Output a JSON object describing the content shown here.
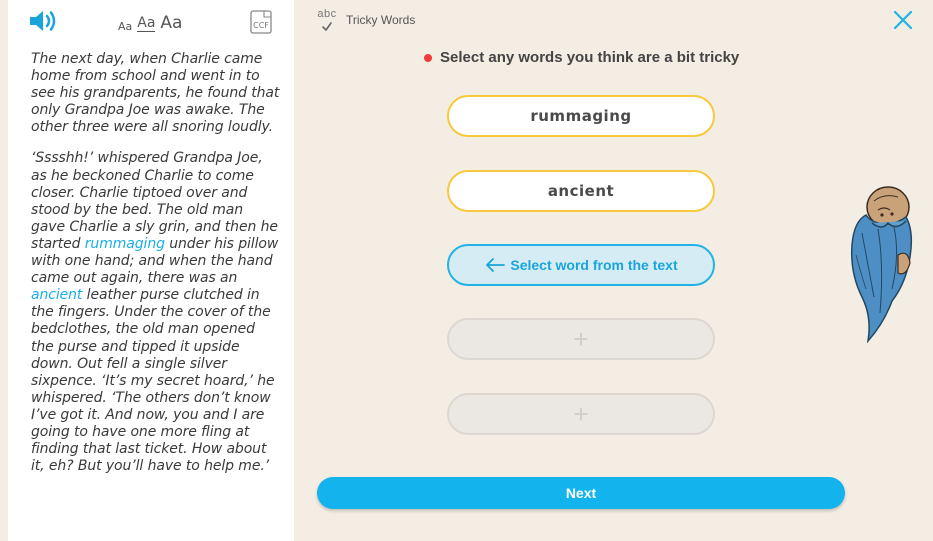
{
  "reader": {
    "font_size_small": "Aa",
    "font_size_medium": "Aa",
    "font_size_large": "Aa",
    "ccf_label": "CCF",
    "passage": [
      [
        {
          "t": "The next day, when Charlie came home from school and went in to see his grandparents, he found that only Grandpa Joe was awake. The other three were all snoring loudly."
        }
      ],
      [
        {
          "t": "‘Sssshh!’ whispered Grandpa Joe, as he beckoned Charlie to come closer. Charlie tiptoed over and stood by the bed. The old man gave Charlie a sly grin, and then he started "
        },
        {
          "t": "rummaging",
          "hl": true
        },
        {
          "t": " under his pillow with one hand; and when the hand came out again, there was an "
        },
        {
          "t": "ancient",
          "hl": true
        },
        {
          "t": " leather purse clutched in the fingers. Under the cover of the bedclothes, the old man opened the purse and tipped it upside down. Out fell a single silver sixpence. ‘It’s my secret hoard,’ he whispered. ‘The others don’t know I’ve got it. And now, you and I are going to have one more fling at finding that last ticket. How about it, eh? But you’ll have to help me.’"
        }
      ]
    ]
  },
  "header": {
    "icon_label": "abc",
    "title": "Tricky Words"
  },
  "prompt": "Select any words you think are a bit tricky",
  "words": [
    "rummaging",
    "ancient"
  ],
  "select_label": "Select word from the text",
  "empty_slot_symbol": "+",
  "next_label": "Next",
  "colors": {
    "accent_blue": "#13b3ee",
    "word_border": "#f7c93c",
    "prompt_dot": "#ef3b3b",
    "highlight_text": "#1aaee8"
  }
}
